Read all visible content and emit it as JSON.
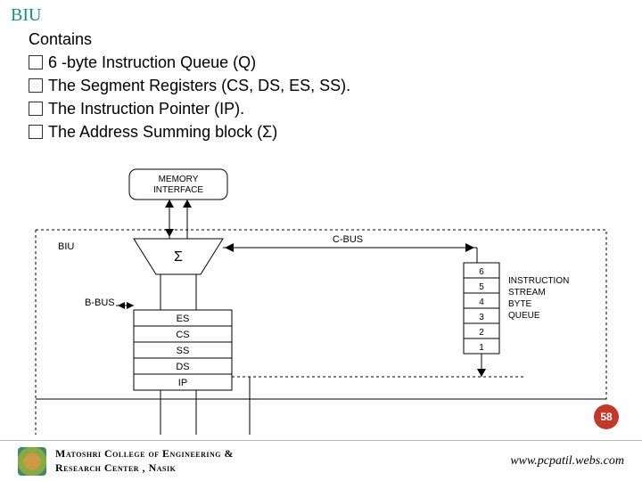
{
  "title": "BIU",
  "contains_label": "Contains",
  "bullets": [
    "6 -byte Instruction Queue (Q)",
    "The Segment Registers (CS, DS, ES, SS).",
    "The Instruction Pointer (IP).",
    "The Address Summing block (Σ)"
  ],
  "diagram": {
    "mem_if": "MEMORY\nINTERFACE",
    "biu_label": "BIU",
    "sigma": "Σ",
    "cbus": "C-BUS",
    "bbus": "B-BUS",
    "regs": [
      "ES",
      "CS",
      "SS",
      "DS",
      "IP"
    ],
    "queue_nums": [
      "6",
      "5",
      "4",
      "3",
      "2",
      "1"
    ],
    "queue_caption": [
      "INSTRUCTION",
      "STREAM",
      "BYTE",
      "QUEUE"
    ]
  },
  "page_number": "58",
  "footer": {
    "college_line1": "Matoshri College of Engineering &",
    "college_line2": "Research Center , Nasik",
    "website": "www.pcpatil.webs.com"
  }
}
